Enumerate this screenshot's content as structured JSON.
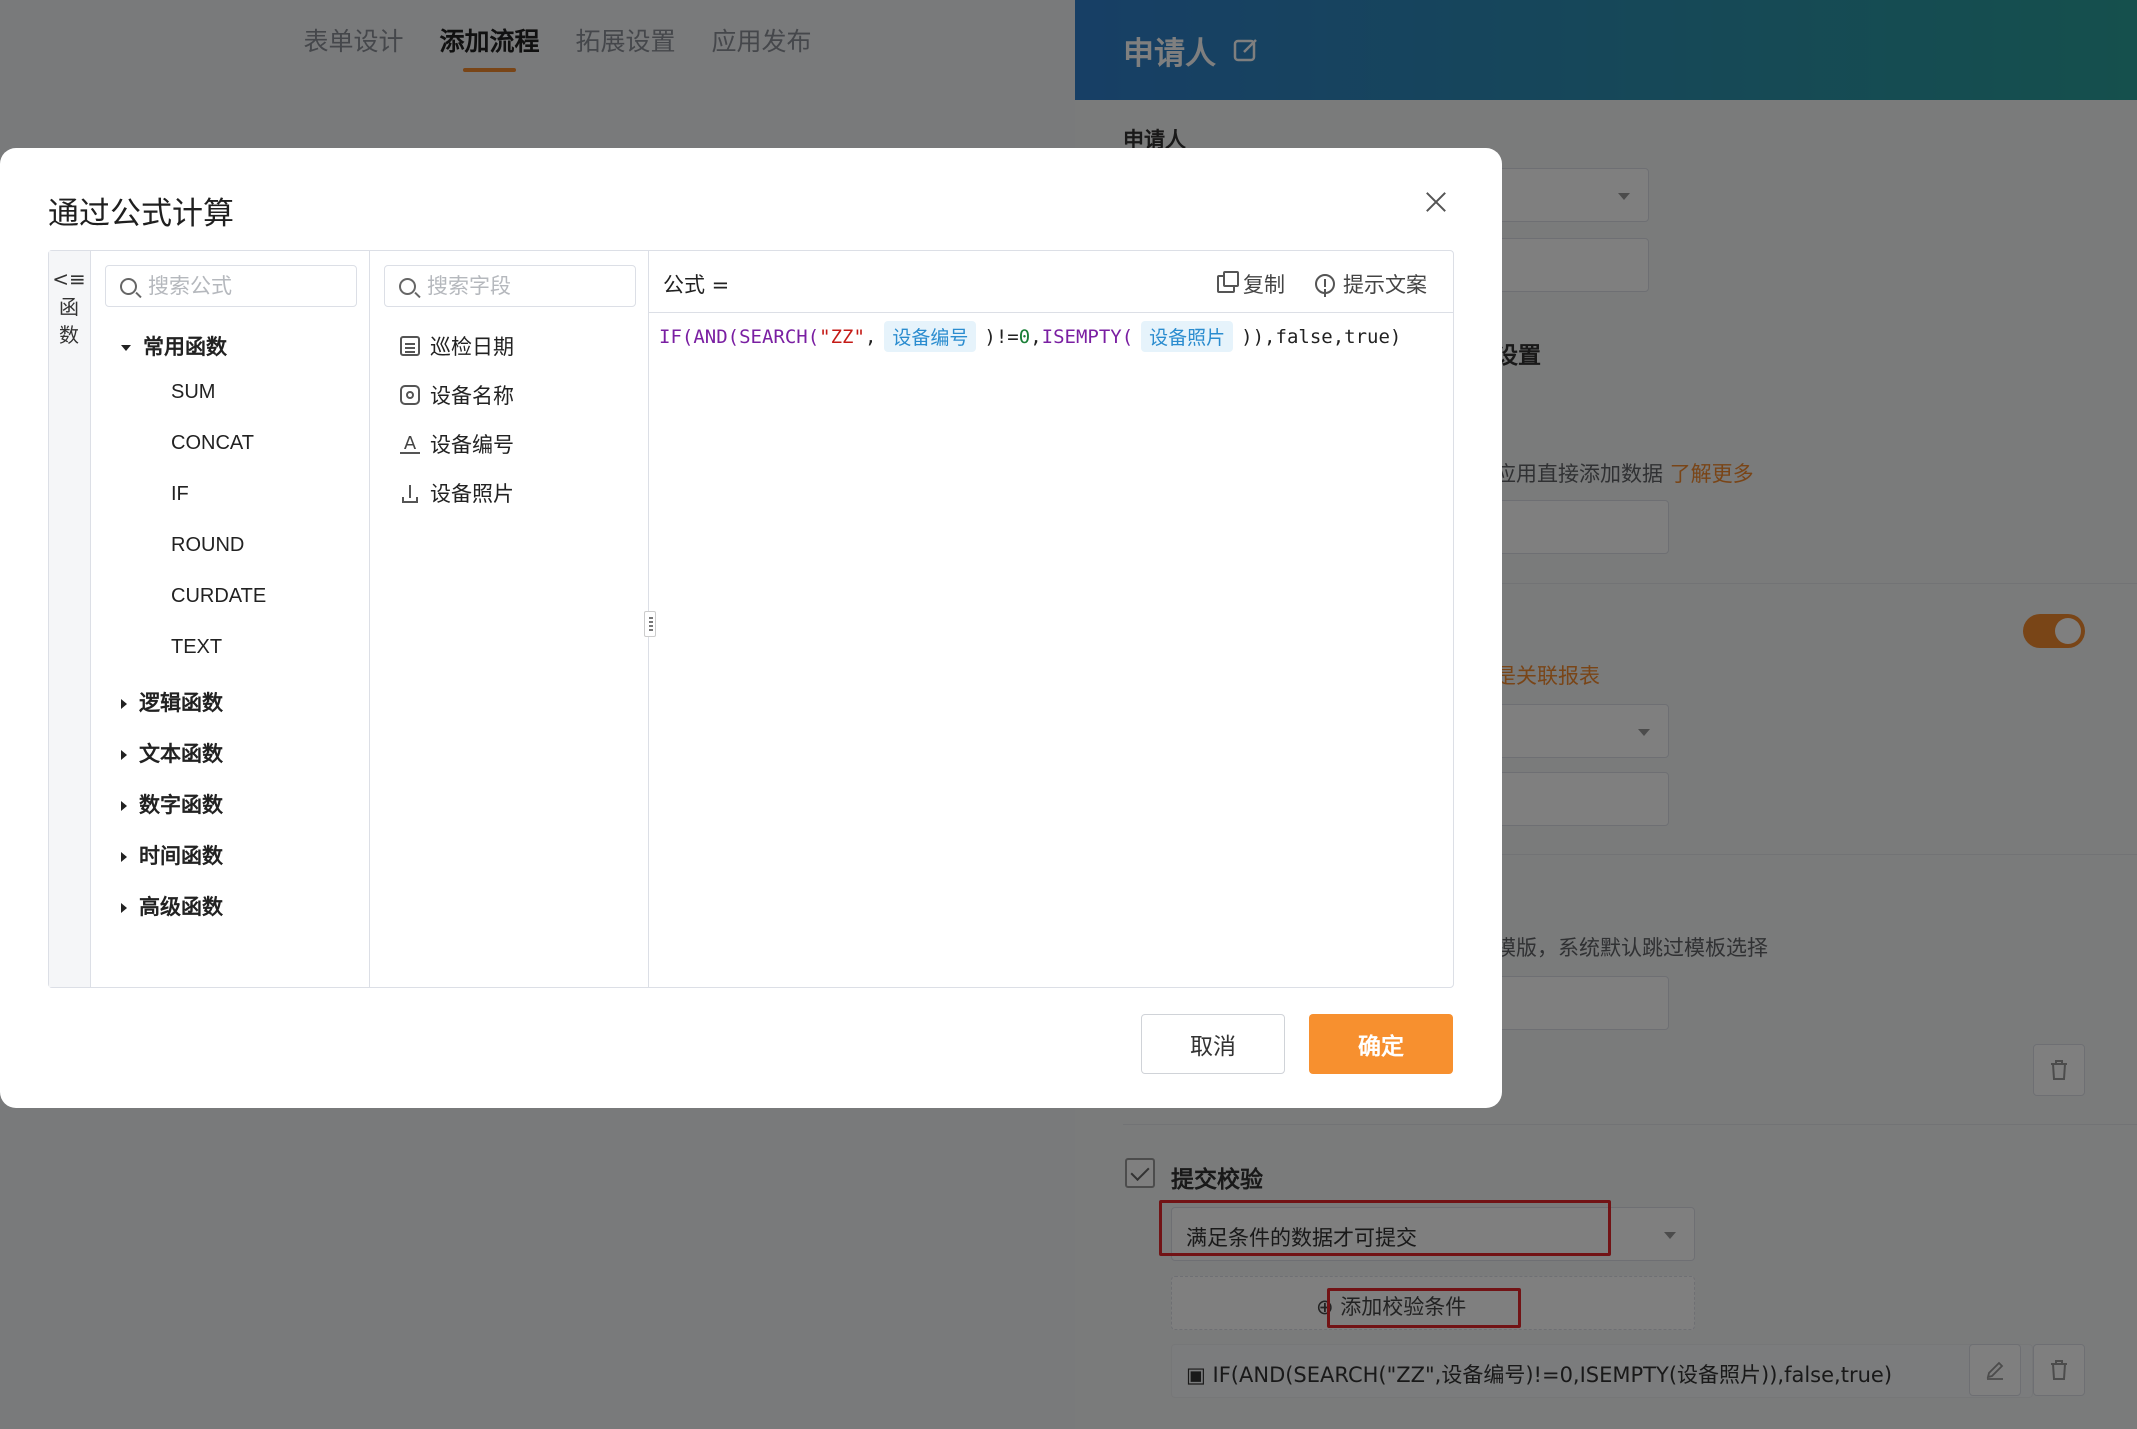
{
  "top_tabs": [
    "表单设计",
    "添加流程",
    "拓展设置",
    "应用发布"
  ],
  "top_tab_active": 1,
  "drawer": {
    "title": "申请人",
    "label_applicant": "申请人",
    "section_tab": "设置",
    "hint_direct": "应用直接添加数据",
    "learn_more": "了解更多",
    "related_report": "是关联报表",
    "template_hint": "模版，系统默认跳过模板选择",
    "submit_check_label": "提交校验",
    "submit_condition": "满足条件的数据才可提交",
    "add_condition": "添加校验条件",
    "condition_formula": "IF(AND(SEARCH(\"ZZ\",设备编号)!=0,ISEMPTY(设备照片)),false,true)"
  },
  "modal": {
    "title": "通过公式计算",
    "collapse_label": [
      "<≡",
      "函",
      "数"
    ],
    "func_search_placeholder": "搜索公式",
    "field_search_placeholder": "搜索字段",
    "common_group": "常用函数",
    "common_functions": [
      "SUM",
      "CONCAT",
      "IF",
      "ROUND",
      "CURDATE",
      "TEXT"
    ],
    "other_groups": [
      "逻辑函数",
      "文本函数",
      "数字函数",
      "时间函数",
      "高级函数"
    ],
    "fields": [
      {
        "label": "巡检日期",
        "icon": "calendar-icon"
      },
      {
        "label": "设备名称",
        "icon": "at-icon"
      },
      {
        "label": "设备编号",
        "icon": "text-icon"
      },
      {
        "label": "设备照片",
        "icon": "upload-icon"
      }
    ],
    "formula_label": "公式 =",
    "copy_label": "复制",
    "hint_label": "提示文案",
    "formula": {
      "p1": "IF(",
      "p2": "AND(",
      "p3": "SEARCH(",
      "p4": "\"ZZ\"",
      "p5": ",",
      "chip1": "设备编号",
      "p6": ")!=",
      "p7": "0",
      "p8": ",",
      "p9": "ISEMPTY(",
      "chip2": "设备照片",
      "p10": ")),",
      "p11": "false,true)"
    },
    "cancel": "取消",
    "ok": "确定"
  }
}
